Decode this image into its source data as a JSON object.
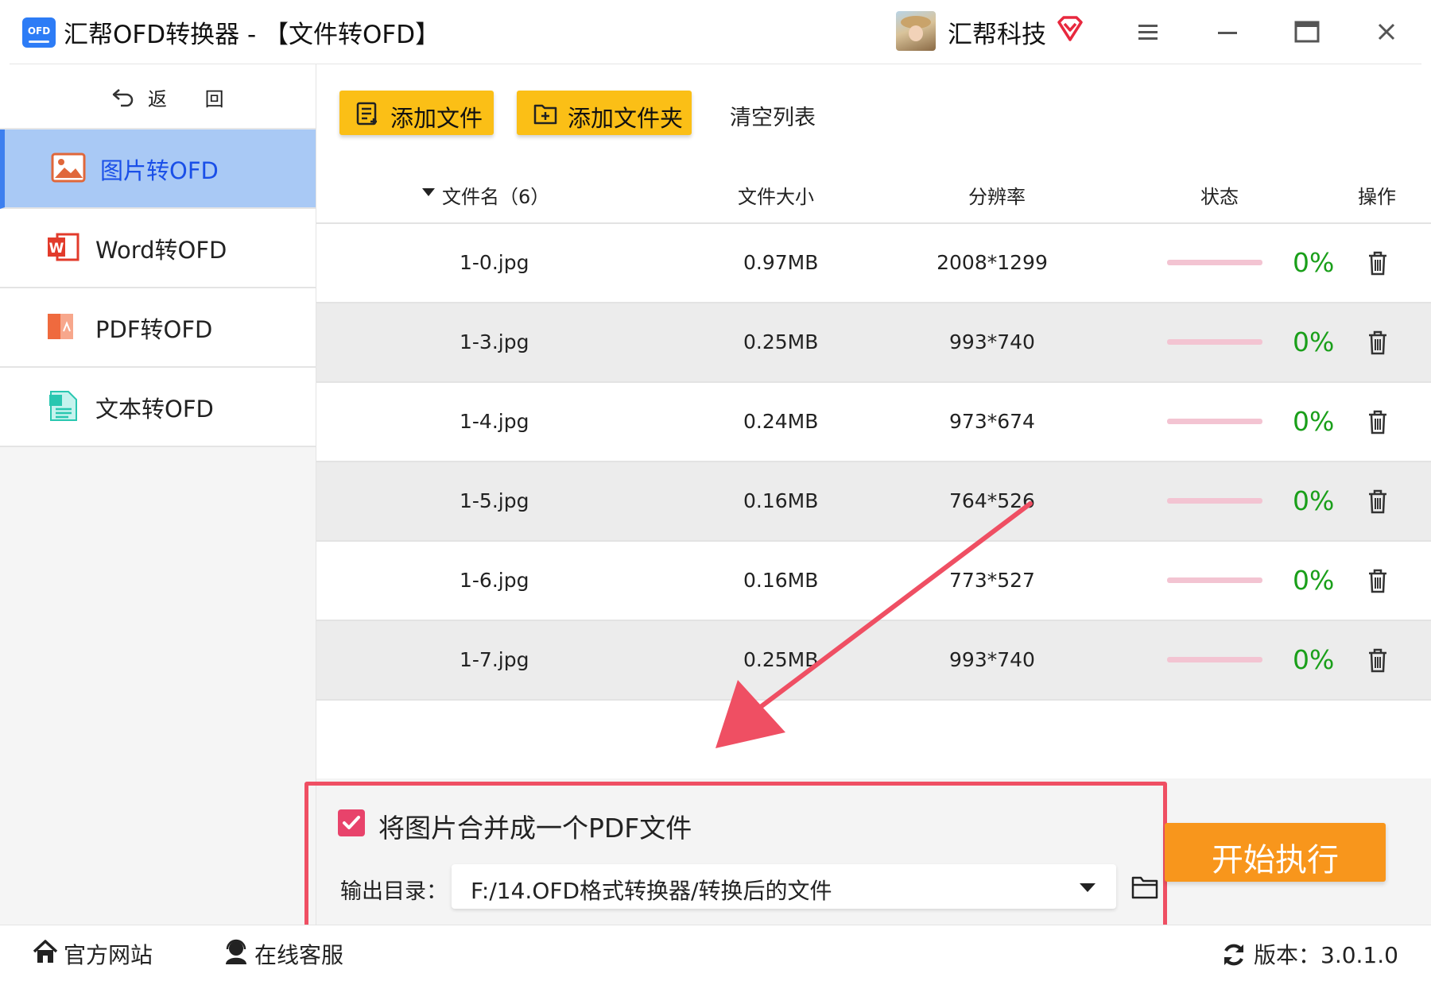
{
  "window": {
    "title": "汇帮OFD转换器 - 【文件转OFD】",
    "logo_text": "OFD",
    "user_name": "汇帮科技",
    "icons": [
      "vip-diamond-icon",
      "menu-icon",
      "minimize-icon",
      "maximize-icon",
      "close-icon"
    ]
  },
  "sidebar": {
    "back_label": "返 回",
    "items": [
      {
        "label": "图片转OFD",
        "icon": "image-icon",
        "active": true
      },
      {
        "label": "Word转OFD",
        "icon": "word-icon",
        "active": false
      },
      {
        "label": "PDF转OFD",
        "icon": "pdf-icon",
        "active": false
      },
      {
        "label": "文本转OFD",
        "icon": "text-file-icon",
        "active": false
      }
    ]
  },
  "toolbar": {
    "add_file": "添加文件",
    "add_folder": "添加文件夹",
    "clear_list": "清空列表"
  },
  "table": {
    "headers": {
      "name": "文件名（6）",
      "size": "文件大小",
      "resolution": "分辨率",
      "status": "状态",
      "action": "操作"
    },
    "rows": [
      {
        "name": "1-0.jpg",
        "size": "0.97MB",
        "resolution": "2008*1299",
        "progress": 0,
        "status": "0%"
      },
      {
        "name": "1-3.jpg",
        "size": "0.25MB",
        "resolution": "993*740",
        "progress": 0,
        "status": "0%"
      },
      {
        "name": "1-4.jpg",
        "size": "0.24MB",
        "resolution": "973*674",
        "progress": 0,
        "status": "0%"
      },
      {
        "name": "1-5.jpg",
        "size": "0.16MB",
        "resolution": "764*526",
        "progress": 0,
        "status": "0%"
      },
      {
        "name": "1-6.jpg",
        "size": "0.16MB",
        "resolution": "773*527",
        "progress": 0,
        "status": "0%"
      },
      {
        "name": "1-7.jpg",
        "size": "0.25MB",
        "resolution": "993*740",
        "progress": 0,
        "status": "0%"
      }
    ]
  },
  "options": {
    "merge_label": "将图片合并成一个PDF文件",
    "merge_checked": true,
    "output_label": "输出目录：",
    "output_path": "F:/14.OFD格式转换器/转换后的文件"
  },
  "start_button": "开始执行",
  "statusbar": {
    "website": "官方网站",
    "support": "在线客服",
    "version": "版本：3.0.1.0"
  },
  "colors": {
    "accent_yellow": "#fbbf16",
    "start_orange": "#f8961c",
    "active_nav_bg": "#a9c9f5",
    "active_nav_text": "#1a4fe8",
    "status_green": "#1a9f1a",
    "progress_pink": "#f3c4d2",
    "highlight_red": "#ef4f63",
    "checkbox_pink": "#e8436b"
  }
}
